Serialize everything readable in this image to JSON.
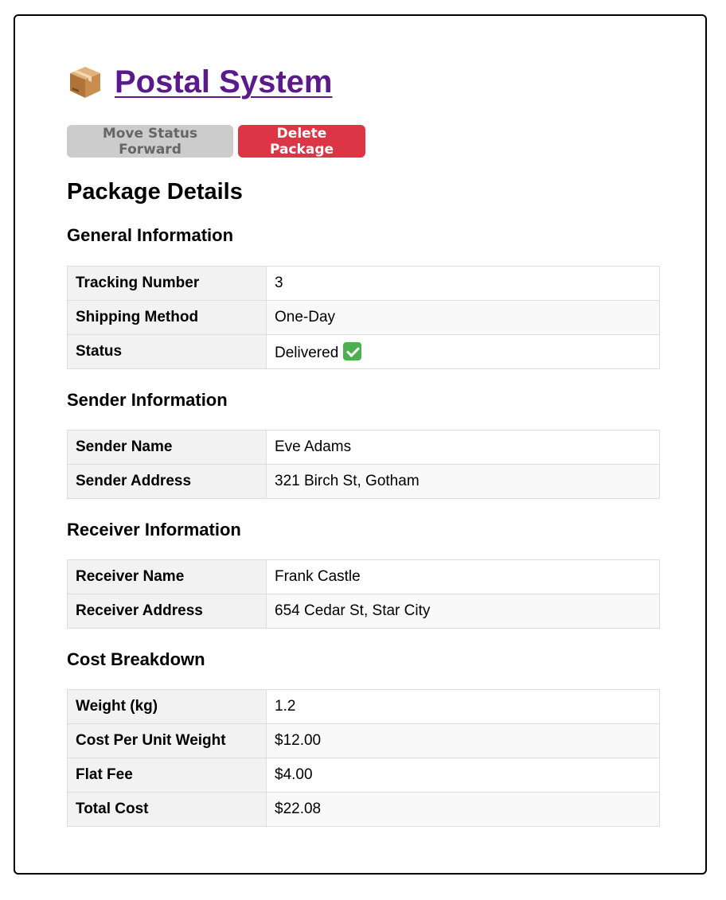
{
  "header": {
    "title": "Postal System",
    "icon": "package-icon"
  },
  "actions": {
    "move_forward_label": "Move Status Forward",
    "delete_label": "Delete Package"
  },
  "page_heading": "Package Details",
  "general": {
    "title": "General Information",
    "rows": [
      {
        "label": "Tracking Number",
        "value": "3"
      },
      {
        "label": "Shipping Method",
        "value": "One-Day"
      },
      {
        "label": "Status",
        "value": "Delivered",
        "icon": "check-mark-icon"
      }
    ]
  },
  "sender": {
    "title": "Sender Information",
    "rows": [
      {
        "label": "Sender Name",
        "value": "Eve Adams"
      },
      {
        "label": "Sender Address",
        "value": "321 Birch St, Gotham"
      }
    ]
  },
  "receiver": {
    "title": "Receiver Information",
    "rows": [
      {
        "label": "Receiver Name",
        "value": "Frank Castle"
      },
      {
        "label": "Receiver Address",
        "value": "654 Cedar St, Star City"
      }
    ]
  },
  "cost": {
    "title": "Cost Breakdown",
    "rows": [
      {
        "label": "Weight (kg)",
        "value": "1.2"
      },
      {
        "label": "Cost Per Unit Weight",
        "value": "$12.00"
      },
      {
        "label": "Flat Fee",
        "value": "$4.00"
      },
      {
        "label": "Total Cost",
        "value": "$22.08"
      }
    ]
  },
  "colors": {
    "title_link": "#5b1a8c",
    "delete_button": "#dc3545",
    "disabled_button": "#cccccc",
    "status_check": "#4caf50"
  }
}
